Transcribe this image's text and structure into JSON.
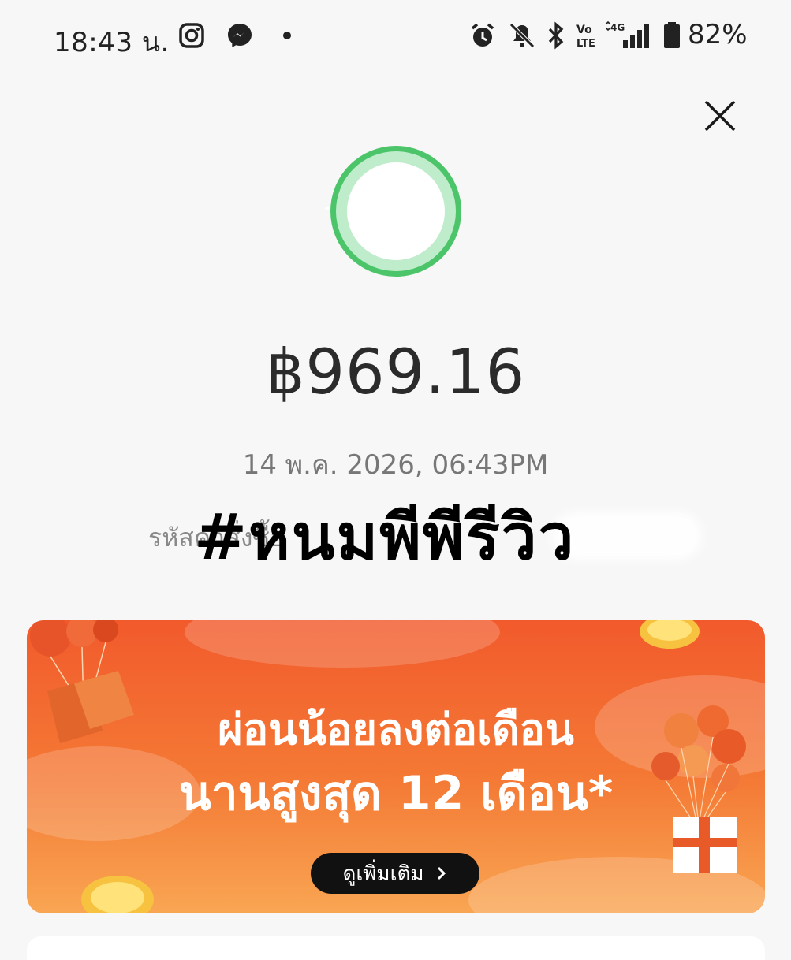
{
  "status_bar": {
    "time": "18:43 น.",
    "battery": "82%",
    "network": "4G",
    "volte": "Vo LTE"
  },
  "payment": {
    "amount": "฿969.16",
    "datetime": "14 พ.ค. 2026, 06:43PM",
    "order_label": "รหัสคำสั่งซื้อ"
  },
  "watermark": "#หนมพีพีรีวิว",
  "banner": {
    "line1": "ผ่อนน้อยลงต่อเดือน",
    "line2": "นานสูงสุด 12 เดือน*",
    "button_label": "ดูเพิ่มเติม"
  },
  "colors": {
    "ring": "#4cc56a",
    "banner_top": "#f25a2c",
    "banner_bottom": "#f9a653"
  },
  "icons": [
    "instagram-icon",
    "messenger-icon",
    "alarm-icon",
    "mute-icon",
    "bluetooth-icon",
    "signal-icon",
    "battery-icon",
    "close-icon"
  ]
}
